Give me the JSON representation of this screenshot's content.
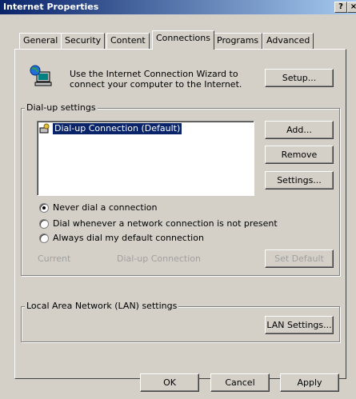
{
  "window": {
    "title": "Internet Properties",
    "help_button": "?",
    "close_button": "×"
  },
  "tabs": [
    {
      "label": "General"
    },
    {
      "label": "Security"
    },
    {
      "label": "Content"
    },
    {
      "label": "Connections",
      "selected": true
    },
    {
      "label": "Programs"
    },
    {
      "label": "Advanced"
    }
  ],
  "wizard": {
    "text_line1": "Use the Internet Connection Wizard to",
    "text_line2": "connect your computer to the Internet.",
    "setup_button": "Setup..."
  },
  "dialup": {
    "group_label": "Dial-up settings",
    "connections": [
      {
        "label": "Dial-up Connection (Default)",
        "selected": true
      }
    ],
    "add_button": "Add...",
    "remove_button": "Remove",
    "settings_button": "Settings...",
    "options": [
      {
        "label": "Never dial a connection",
        "checked": true
      },
      {
        "label": "Dial whenever a network connection is not present",
        "checked": false
      },
      {
        "label": "Always dial my default connection",
        "checked": false
      }
    ],
    "current_label": "Current",
    "current_value": "Dial-up Connection",
    "set_default_button": "Set Default"
  },
  "lan": {
    "group_label": "Local Area Network (LAN) settings",
    "lan_settings_button": "LAN Settings..."
  },
  "footer": {
    "ok_button": "OK",
    "cancel_button": "Cancel",
    "apply_button": "Apply"
  },
  "colors": {
    "titlebar_start": "#0a246a",
    "titlebar_end": "#a6caf0",
    "face": "#d4d0c8",
    "selection": "#0a246a"
  }
}
